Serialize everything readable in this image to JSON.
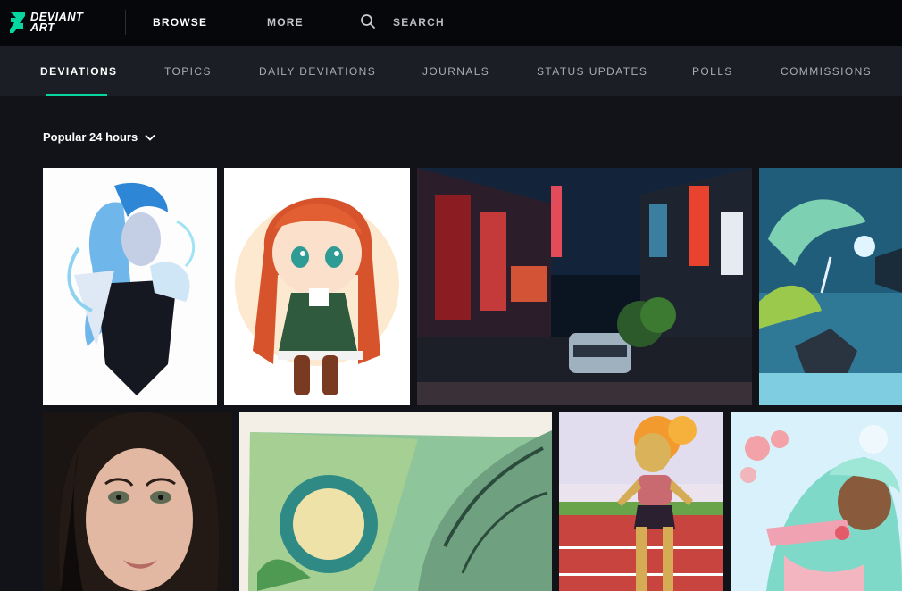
{
  "brand": {
    "line1": "DEVIANT",
    "line2": "ART",
    "accent": "#06d6a0"
  },
  "topnav": {
    "browse": "BROWSE",
    "more": "MORE",
    "search_icon": "search-icon",
    "search_label": "SEARCH"
  },
  "tabs": [
    {
      "label": "DEVIATIONS",
      "active": true
    },
    {
      "label": "TOPICS"
    },
    {
      "label": "DAILY DEVIATIONS"
    },
    {
      "label": "JOURNALS"
    },
    {
      "label": "STATUS UPDATES"
    },
    {
      "label": "POLLS"
    },
    {
      "label": "COMMISSIONS"
    }
  ],
  "sort": {
    "label": "Popular 24 hours",
    "icon": "chevron-down-icon"
  },
  "gallery": {
    "row1": [
      {
        "subject": "blue-haired woman with dragon artwork"
      },
      {
        "subject": "chibi red-haired girl artwork"
      },
      {
        "subject": "neon city street at night photo"
      },
      {
        "subject": "blue unicorn and dragon fantasy artwork"
      }
    ],
    "row2": [
      {
        "subject": "3d portrait of dark-haired woman"
      },
      {
        "subject": "watercolor green dragon artwork"
      },
      {
        "subject": "athlete girl on running track artwork"
      },
      {
        "subject": "mint-haired girl with bubbles artwork"
      }
    ]
  }
}
